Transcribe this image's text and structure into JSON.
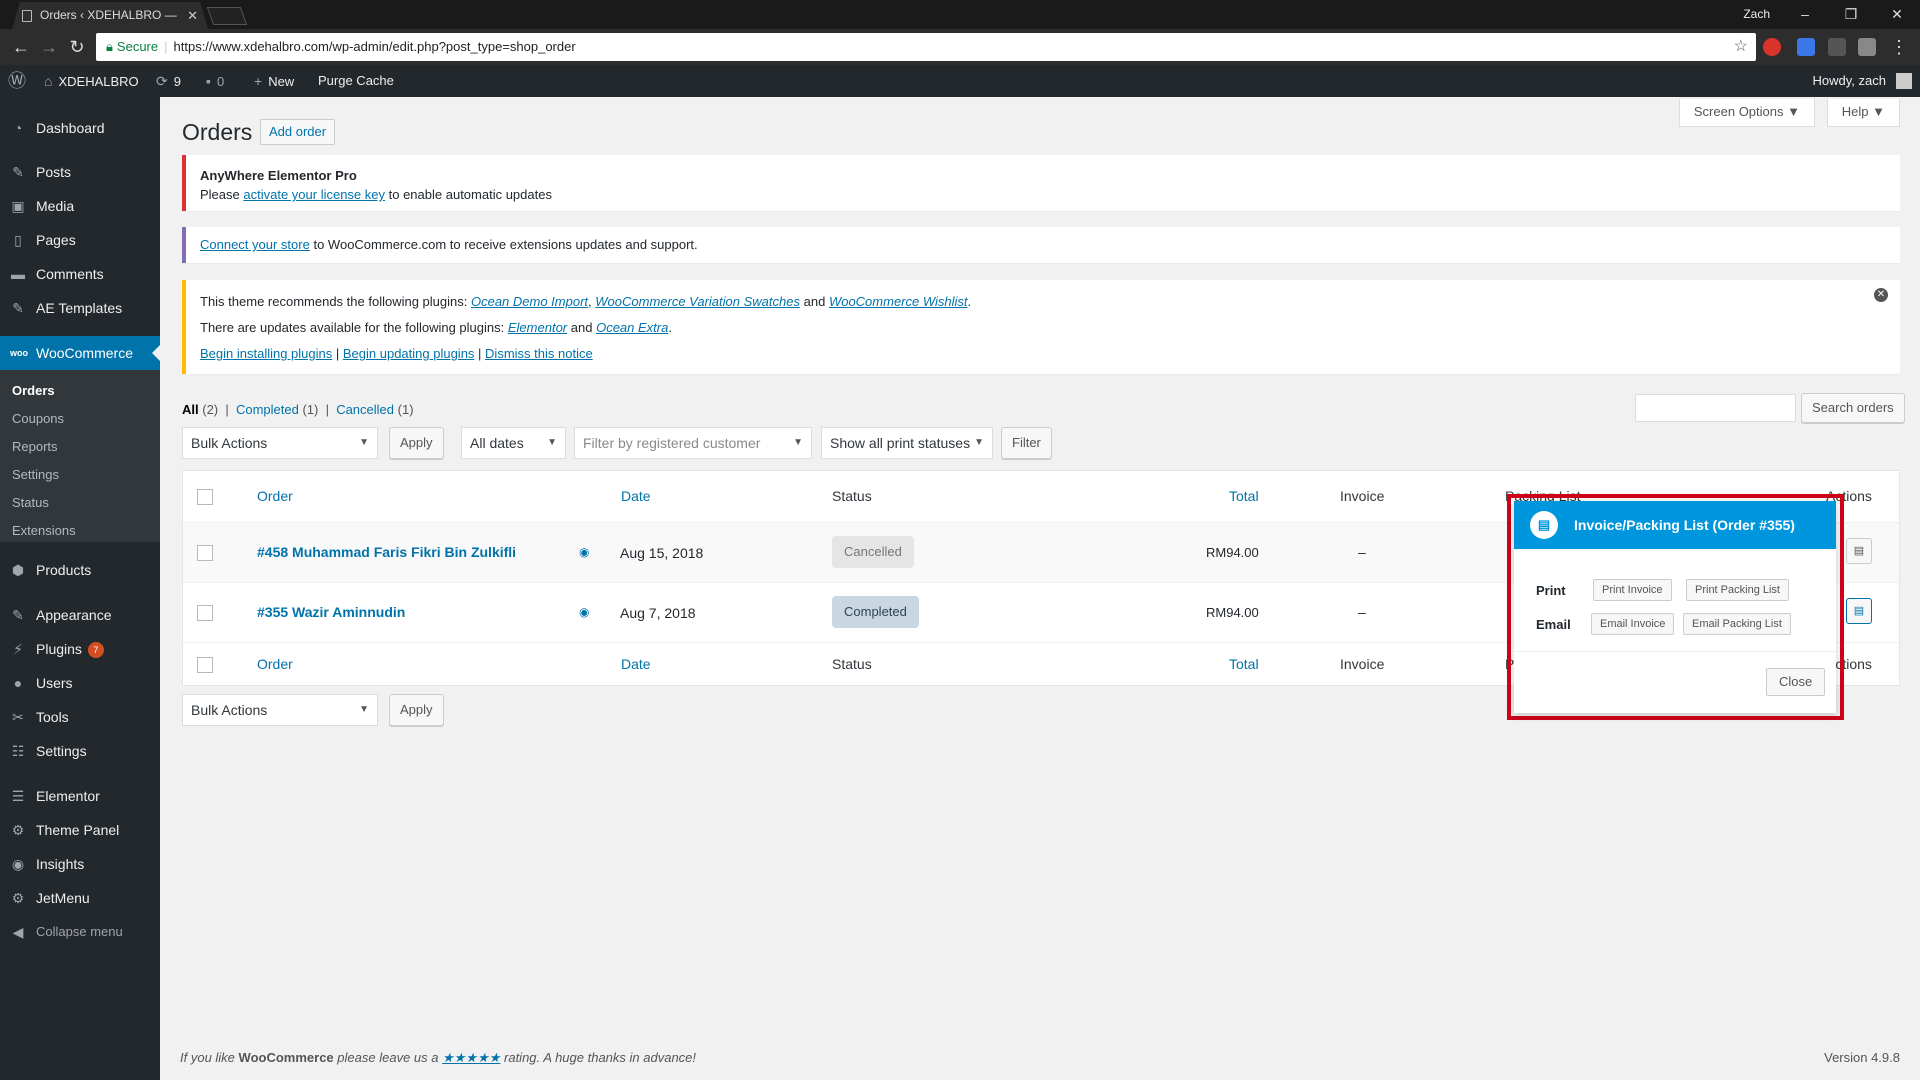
{
  "browser": {
    "tab_title": "Orders ‹ XDEHALBRO —",
    "tab_close": "✕",
    "window_user": "Zach",
    "secure_label": "Secure",
    "url": "https://www.xdehalbro.com/wp-admin/edit.php?post_type=shop_order"
  },
  "adminbar": {
    "site_name": "XDEHALBRO",
    "updates_count": "9",
    "comments_count": "0",
    "new_label": "New",
    "purge_cache": "Purge Cache",
    "howdy": "Howdy, zach"
  },
  "sidebar": {
    "items": [
      {
        "label": "Dashboard",
        "icon": "dashboard-icon"
      },
      {
        "label": "Posts",
        "icon": "pin-icon"
      },
      {
        "label": "Media",
        "icon": "media-icon"
      },
      {
        "label": "Pages",
        "icon": "page-icon"
      },
      {
        "label": "Comments",
        "icon": "comment-icon"
      },
      {
        "label": "AE Templates",
        "icon": "pin-icon"
      },
      {
        "label": "WooCommerce",
        "icon": "woocommerce-icon"
      },
      {
        "label": "Products",
        "icon": "box-icon"
      },
      {
        "label": "Appearance",
        "icon": "brush-icon"
      },
      {
        "label": "Plugins",
        "icon": "plug-icon",
        "badge": "7"
      },
      {
        "label": "Users",
        "icon": "user-icon"
      },
      {
        "label": "Tools",
        "icon": "wrench-icon"
      },
      {
        "label": "Settings",
        "icon": "settings-icon"
      },
      {
        "label": "Elementor",
        "icon": "elementor-icon"
      },
      {
        "label": "Theme Panel",
        "icon": "gear-icon"
      },
      {
        "label": "Insights",
        "icon": "insights-icon"
      },
      {
        "label": "JetMenu",
        "icon": "gear-icon"
      },
      {
        "label": "Collapse menu",
        "icon": "collapse-icon"
      }
    ],
    "submenu": [
      "Orders",
      "Coupons",
      "Reports",
      "Settings",
      "Status",
      "Extensions"
    ]
  },
  "header": {
    "screen_options": "Screen Options",
    "help": "Help",
    "title": "Orders",
    "add_order": "Add order"
  },
  "notices": {
    "n1_title": "AnyWhere Elementor Pro",
    "n1_pre": "Please",
    "n1_link": "activate your license key",
    "n1_post": "to enable automatic updates",
    "n2_link": "Connect your store",
    "n2_post": "to WooCommerce.com to receive extensions updates and support.",
    "n3_line1_pre": "This theme recommends the following plugins:",
    "n3_p1": "Ocean Demo Import",
    "n3_p2": "WooCommerce Variation Swatches",
    "n3_and": "and",
    "n3_p3": "WooCommerce Wishlist",
    "n3_line2_pre": "There are updates available for the following plugins:",
    "n3_u1": "Elementor",
    "n3_u2": "Ocean Extra",
    "n3_a1": "Begin installing plugins",
    "n3_a2": "Begin updating plugins",
    "n3_a3": "Dismiss this notice"
  },
  "filters": {
    "all": "All",
    "all_count": "(2)",
    "completed": "Completed",
    "completed_count": "(1)",
    "cancelled": "Cancelled",
    "cancelled_count": "(1)",
    "bulk_actions": "Bulk Actions",
    "apply": "Apply",
    "all_dates": "All dates",
    "customer_placeholder": "Filter by registered customer",
    "print_status": "Show all print statuses",
    "filter": "Filter",
    "search_orders": "Search orders"
  },
  "table": {
    "columns": {
      "order": "Order",
      "date": "Date",
      "status": "Status",
      "total": "Total",
      "invoice": "Invoice",
      "packing": "Packing List",
      "actions": "Actions"
    },
    "rows": [
      {
        "order": "#458 Muhammad Faris Fikri Bin Zulkifli",
        "date": "Aug 15, 2018",
        "status": "Cancelled",
        "total": "RM94.00",
        "invoice": "–"
      },
      {
        "order": "#355 Wazir Aminnudin",
        "date": "Aug 7, 2018",
        "status": "Completed",
        "total": "RM94.00",
        "invoice": "–"
      }
    ]
  },
  "popup": {
    "title": "Invoice/Packing List (Order #355)",
    "print_label": "Print",
    "email_label": "Email",
    "print_invoice": "Print Invoice",
    "print_packing": "Print Packing List",
    "email_invoice": "Email Invoice",
    "email_packing": "Email Packing List",
    "close": "Close"
  },
  "footer": {
    "pre": "If you like",
    "brand": "WooCommerce",
    "mid": "please leave us a",
    "stars": "★★★★★",
    "post": "rating. A huge thanks in advance!",
    "version": "Version 4.9.8"
  },
  "colors": {
    "accent": "#0073aa",
    "popup_header": "#0096dd",
    "highlight": "#d0021b"
  }
}
